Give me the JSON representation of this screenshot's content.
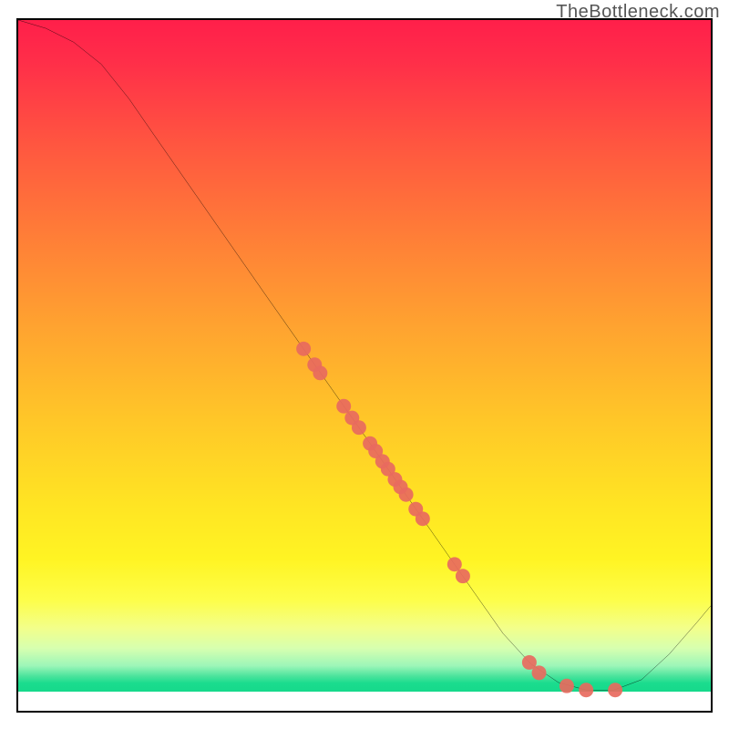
{
  "watermark": "TheBottleneck.com",
  "chart_data": {
    "type": "line",
    "title": "",
    "xlabel": "",
    "ylabel": "",
    "xlim": [
      0,
      100
    ],
    "ylim": [
      0,
      100
    ],
    "grid": false,
    "line": {
      "name": "bottleneck-curve",
      "color": "#000000",
      "points": [
        {
          "x": 0.0,
          "y": 100.0
        },
        {
          "x": 4.0,
          "y": 98.8
        },
        {
          "x": 8.0,
          "y": 96.8
        },
        {
          "x": 12.0,
          "y": 93.6
        },
        {
          "x": 16.0,
          "y": 88.6
        },
        {
          "x": 20.0,
          "y": 82.8
        },
        {
          "x": 28.0,
          "y": 71.3
        },
        {
          "x": 36.0,
          "y": 59.8
        },
        {
          "x": 44.0,
          "y": 48.4
        },
        {
          "x": 52.0,
          "y": 37.0
        },
        {
          "x": 60.0,
          "y": 25.5
        },
        {
          "x": 66.0,
          "y": 16.9
        },
        {
          "x": 70.0,
          "y": 11.2
        },
        {
          "x": 74.0,
          "y": 6.8
        },
        {
          "x": 78.0,
          "y": 4.1
        },
        {
          "x": 82.0,
          "y": 3.0
        },
        {
          "x": 86.0,
          "y": 3.0
        },
        {
          "x": 90.0,
          "y": 4.5
        },
        {
          "x": 94.0,
          "y": 8.2
        },
        {
          "x": 98.0,
          "y": 12.8
        },
        {
          "x": 100.0,
          "y": 15.2
        }
      ]
    },
    "scatter": {
      "name": "highlighted-points",
      "color": "#e86a5e",
      "points": [
        {
          "x": 41.2,
          "y": 52.4
        },
        {
          "x": 42.8,
          "y": 50.1
        },
        {
          "x": 43.6,
          "y": 48.9
        },
        {
          "x": 47.0,
          "y": 44.1
        },
        {
          "x": 48.2,
          "y": 42.4
        },
        {
          "x": 49.2,
          "y": 41.0
        },
        {
          "x": 50.8,
          "y": 38.7
        },
        {
          "x": 51.6,
          "y": 37.6
        },
        {
          "x": 52.6,
          "y": 36.1
        },
        {
          "x": 53.4,
          "y": 35.0
        },
        {
          "x": 54.4,
          "y": 33.5
        },
        {
          "x": 55.2,
          "y": 32.4
        },
        {
          "x": 56.0,
          "y": 31.3
        },
        {
          "x": 57.4,
          "y": 29.2
        },
        {
          "x": 58.4,
          "y": 27.8
        },
        {
          "x": 63.0,
          "y": 21.2
        },
        {
          "x": 64.2,
          "y": 19.5
        },
        {
          "x": 73.8,
          "y": 7.0
        },
        {
          "x": 75.2,
          "y": 5.5
        },
        {
          "x": 79.2,
          "y": 3.6
        },
        {
          "x": 82.0,
          "y": 3.0
        },
        {
          "x": 86.2,
          "y": 3.0
        }
      ]
    }
  }
}
